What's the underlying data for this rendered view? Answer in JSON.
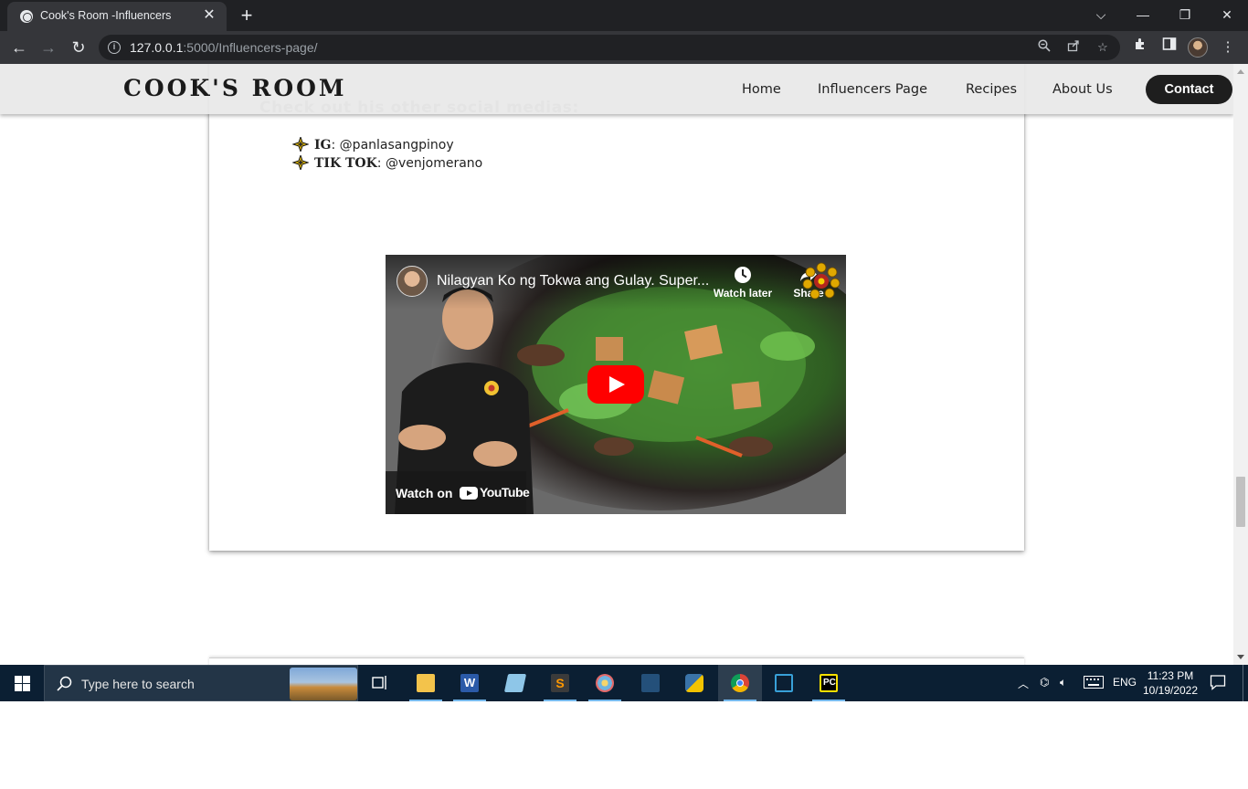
{
  "browser": {
    "tab_title": "Cook's Room -Influencers",
    "url_host": "127.0.0.1",
    "url_rest": ":5000/Influencers-page/"
  },
  "site": {
    "brand": "COOK'S ROOM",
    "nav": [
      "Home",
      "Influencers Page",
      "Recipes",
      "About Us"
    ],
    "contact_label": "Contact"
  },
  "content": {
    "social_heading": "Check out his other social medias:",
    "socials": [
      {
        "platform": "IG",
        "handle": ": @panlasangpinoy"
      },
      {
        "platform": "TIK TOK",
        "handle": ": @venjomerano"
      }
    ],
    "video": {
      "title": "Nilagyan Ko ng Tokwa ang Gulay. Super...",
      "watch_later": "Watch later",
      "share": "Share",
      "watch_on": "Watch on",
      "youtube": "YouTube"
    }
  },
  "taskbar": {
    "search_placeholder": "Type here to search",
    "language": "ENG",
    "time": "11:23 PM",
    "date": "10/19/2022"
  },
  "colors": {
    "chrome_dark": "#202124",
    "chrome_toolbar": "#35363a",
    "navbar_bg": "#e8e8e8",
    "contact_bg": "#1e1e1e",
    "heading_gray": "#a3a3a3",
    "youtube_red": "#ff0000",
    "taskbar_bg": "#0b1f33"
  }
}
